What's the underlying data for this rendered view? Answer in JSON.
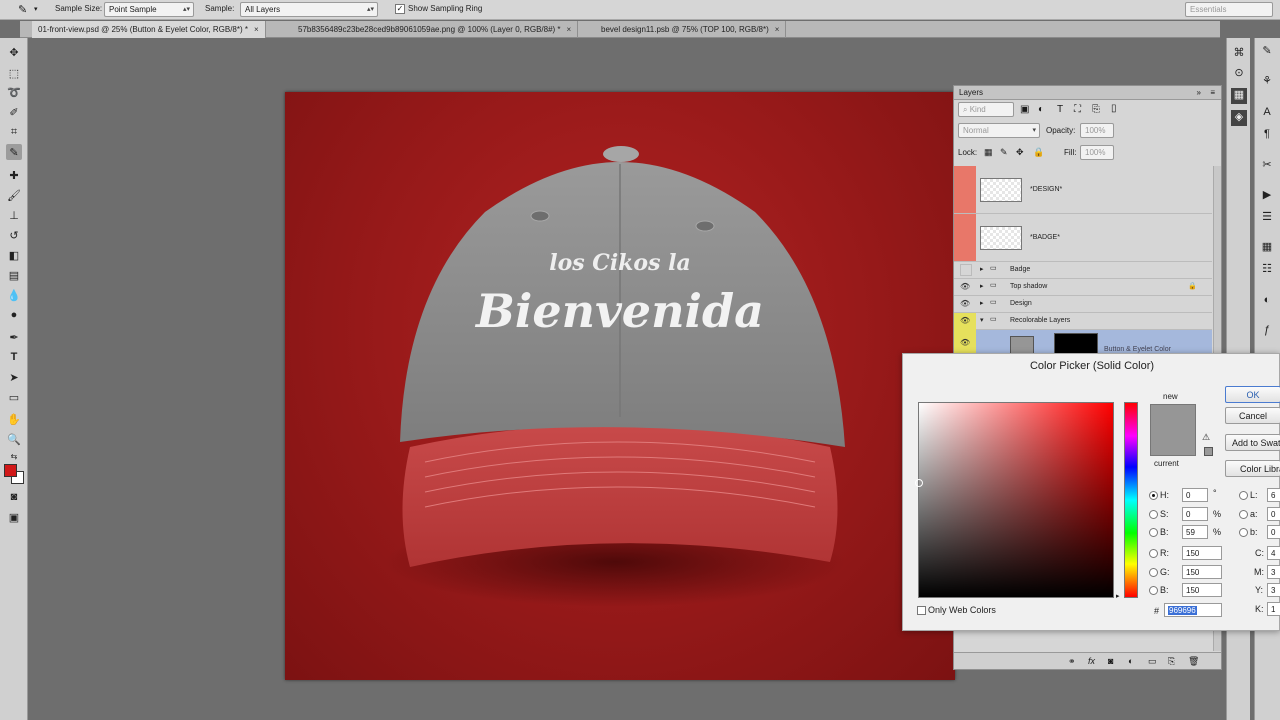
{
  "options_bar": {
    "sample_size_label": "Sample Size:",
    "sample_size_value": "Point Sample",
    "sample_label": "Sample:",
    "sample_value": "All Layers",
    "show_ring_label": "Show Sampling Ring",
    "workspace": "Essentials"
  },
  "tabs": [
    {
      "label": "01-front-view.psd @ 25% (Button & Eyelet Color, RGB/8*) *"
    },
    {
      "label": "57b8356489c23be28ced9b89061059ae.png @ 100% (Layer 0, RGB/8#) *"
    },
    {
      "label": "bevel design11.psb @ 75% (TOP 100, RGB/8*)"
    }
  ],
  "layers_panel": {
    "title": "Layers",
    "kind_placeholder": "Kind",
    "blend_mode": "Normal",
    "opacity_label": "Opacity:",
    "opacity_value": "100%",
    "lock_label": "Lock:",
    "fill_label": "Fill:",
    "fill_value": "100%",
    "layers": [
      {
        "name": "*DESIGN*"
      },
      {
        "name": "*BADGE*"
      },
      {
        "name": "Badge"
      },
      {
        "name": "Top shadow"
      },
      {
        "name": "Design"
      },
      {
        "name": "Recolorable Layers"
      },
      {
        "name": "Button & Eyelet Color"
      }
    ]
  },
  "color_picker": {
    "title": "Color Picker (Solid Color)",
    "new_label": "new",
    "current_label": "current",
    "ok_label": "OK",
    "cancel_label": "Cancel",
    "add_swatch_label": "Add to Swatches",
    "color_libraries_label": "Color Libraries",
    "only_web_label": "Only Web Colors",
    "hex_label": "#",
    "hex_value": "969696",
    "fields": {
      "H": {
        "label": "H:",
        "value": "0",
        "unit": "°"
      },
      "S": {
        "label": "S:",
        "value": "0",
        "unit": "%"
      },
      "B": {
        "label": "B:",
        "value": "59",
        "unit": "%"
      },
      "R": {
        "label": "R:",
        "value": "150"
      },
      "G": {
        "label": "G:",
        "value": "150"
      },
      "B2": {
        "label": "B:",
        "value": "150"
      },
      "L": {
        "label": "L:",
        "value": "6"
      },
      "a": {
        "label": "a:",
        "value": "0"
      },
      "b": {
        "label": "b:",
        "value": "0"
      },
      "C": {
        "label": "C:",
        "value": "4"
      },
      "M": {
        "label": "M:",
        "value": "3"
      },
      "Y": {
        "label": "Y:",
        "value": "3"
      },
      "K": {
        "label": "K:",
        "value": "1"
      }
    },
    "swatch_color": "#969696"
  },
  "canvas": {
    "cap_text_small": "los Cikos la",
    "cap_text_large": "Bienvenida",
    "background_color": "#a71c1c",
    "crown_color": "#8c8c8c",
    "brim_color": "#c24646"
  }
}
